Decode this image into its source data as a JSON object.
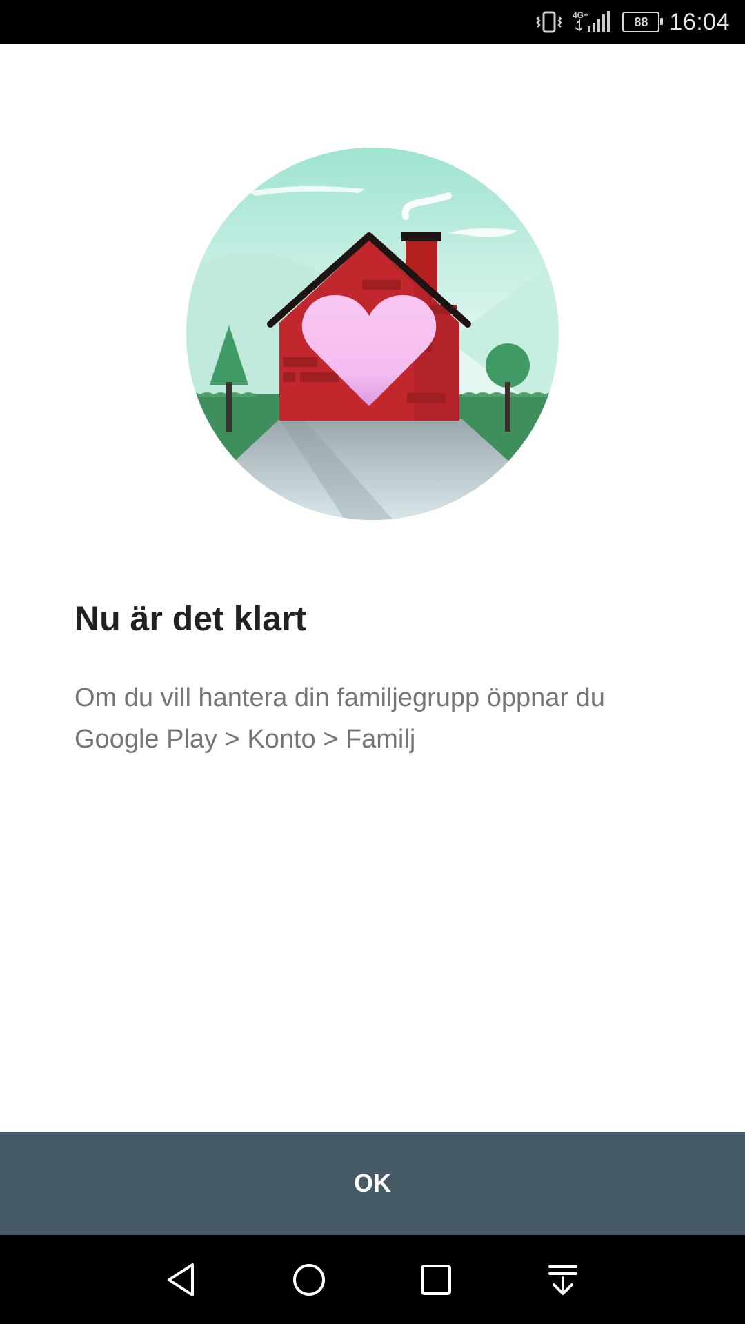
{
  "status_bar": {
    "time": "16:04",
    "battery": "88",
    "network": "4G+",
    "icons": [
      "vibrate-icon",
      "signal-icon",
      "battery-icon"
    ]
  },
  "illustration": {
    "icon": "family-house-heart-illustration"
  },
  "content": {
    "title": "Nu är det klart",
    "body": "Om du vill hantera din familjegrupp öppnar du Google Play > Konto > Familj"
  },
  "actions": {
    "ok_label": "OK"
  },
  "nav_bar": {
    "icons": [
      "back-icon",
      "home-icon",
      "recents-icon",
      "notification-pull-icon"
    ]
  },
  "colors": {
    "button_bg": "#455a64",
    "title": "#212121",
    "body": "#757575"
  }
}
